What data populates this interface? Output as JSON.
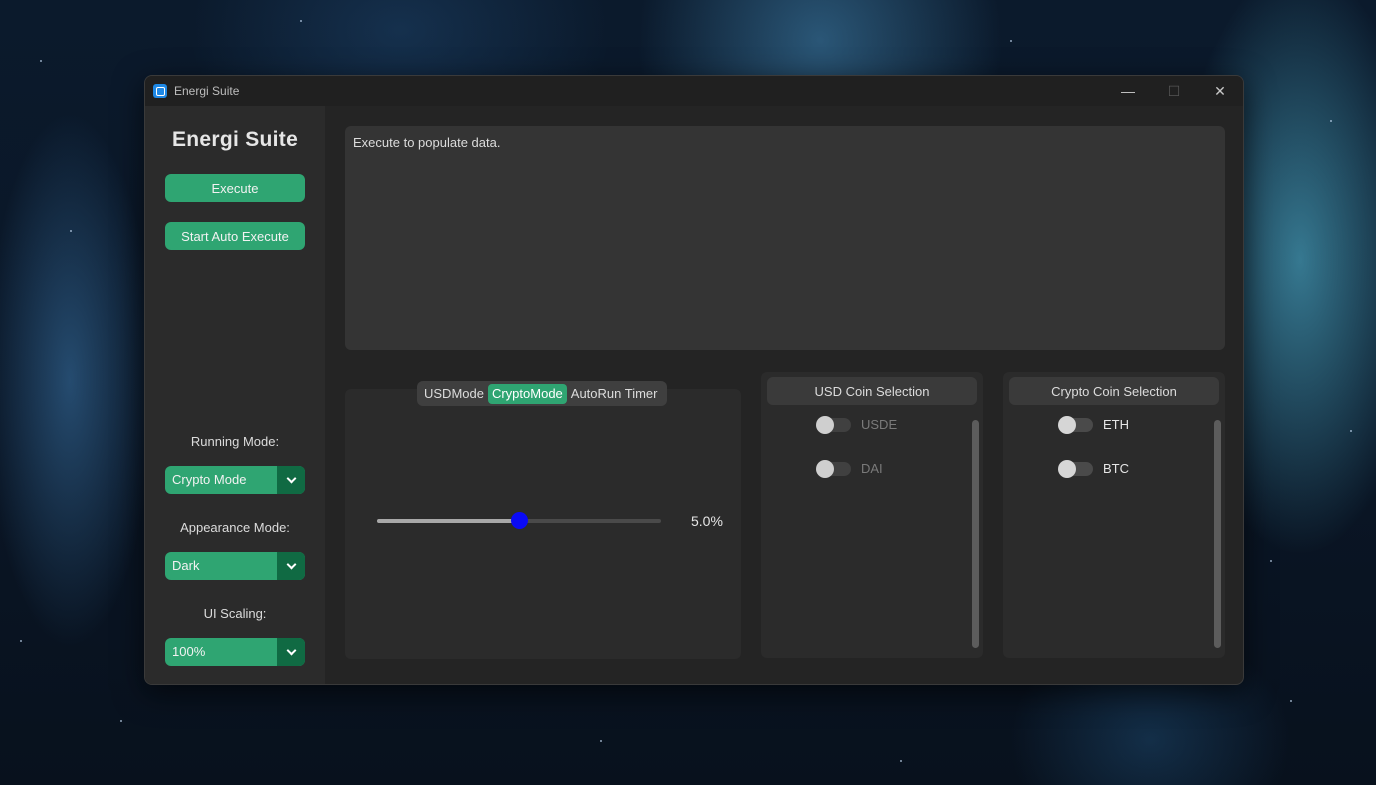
{
  "window": {
    "title": "Energi Suite",
    "controls": {
      "minimize": "—",
      "maximize": "☐",
      "close": "✕"
    }
  },
  "sidebar": {
    "brand": "Energi Suite",
    "execute_label": "Execute",
    "auto_execute_label": "Start Auto Execute",
    "running_mode": {
      "label": "Running Mode:",
      "value": "Crypto Mode"
    },
    "appearance_mode": {
      "label": "Appearance Mode:",
      "value": "Dark"
    },
    "ui_scaling": {
      "label": "UI Scaling:",
      "value": "100%"
    }
  },
  "output": {
    "text": "Execute to populate data."
  },
  "tabs": {
    "items": [
      "USDMode",
      "CryptoMode",
      "AutoRun Timer"
    ],
    "active": "CryptoMode"
  },
  "slider": {
    "value": 0.5,
    "display": "5.0%"
  },
  "usd_coins": {
    "header": "USD Coin Selection",
    "items": [
      {
        "label": "USDE",
        "on": false,
        "disabled": true
      },
      {
        "label": "DAI",
        "on": false,
        "disabled": true
      }
    ]
  },
  "crypto_coins": {
    "header": "Crypto Coin Selection",
    "items": [
      {
        "label": "ETH",
        "on": false,
        "disabled": false
      },
      {
        "label": "BTC",
        "on": false,
        "disabled": false
      }
    ]
  },
  "colors": {
    "accent": "#2fa572",
    "accent_dark": "#106a43",
    "slider_knob": "#0a0af5"
  }
}
